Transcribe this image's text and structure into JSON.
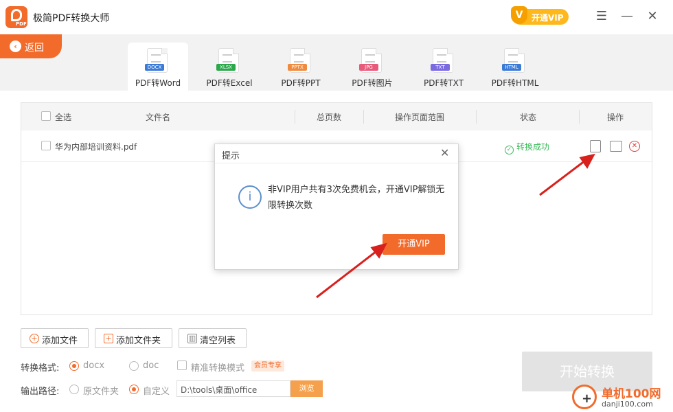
{
  "app": {
    "title": "极简PDF转换大师",
    "vip_label": "开通VIP"
  },
  "nav": {
    "back_label": "返回"
  },
  "tabs": [
    {
      "label": "PDF转Word",
      "tag": "DOCX",
      "color": "#3b7bd8"
    },
    {
      "label": "PDF转Excel",
      "tag": "XLSX",
      "color": "#2aa84a"
    },
    {
      "label": "PDF转PPT",
      "tag": "PPTX",
      "color": "#f08a3c"
    },
    {
      "label": "PDF转图片",
      "tag": "JPG",
      "color": "#e85a7a"
    },
    {
      "label": "PDF转TXT",
      "tag": "TXT",
      "color": "#7a6ae0"
    },
    {
      "label": "PDF转HTML",
      "tag": "HTML",
      "color": "#3b7bd8"
    }
  ],
  "table": {
    "headers": {
      "select_all": "全选",
      "filename": "文件名",
      "pages": "总页数",
      "range": "操作页面范围",
      "status": "状态",
      "actions": "操作"
    },
    "rows": [
      {
        "filename": "华为内部培训资料.pdf",
        "status": "转换成功"
      }
    ]
  },
  "dialog": {
    "title": "提示",
    "message": "非VIP用户共有3次免费机会，开通VIP解锁无限转换次数",
    "confirm_label": "开通VIP"
  },
  "actions": {
    "add_file": "添加文件",
    "add_folder": "添加文件夹",
    "clear_list": "清空列表"
  },
  "format": {
    "label": "转换格式:",
    "option_docx": "docx",
    "option_doc": "doc",
    "precise_mode": "精准转换模式",
    "member_tag": "会员专享"
  },
  "output": {
    "label": "输出路径:",
    "option_source": "原文件夹",
    "option_custom": "自定义",
    "path": "D:\\tools\\桌面\\office",
    "browse_label": "浏览"
  },
  "start_label": "开始转换",
  "watermark": {
    "site": "单机100网",
    "url": "danji100.com"
  },
  "colors": {
    "accent": "#f26b2b",
    "success": "#3aba5a",
    "danger": "#e23b3b",
    "arrow": "#d8201d"
  }
}
